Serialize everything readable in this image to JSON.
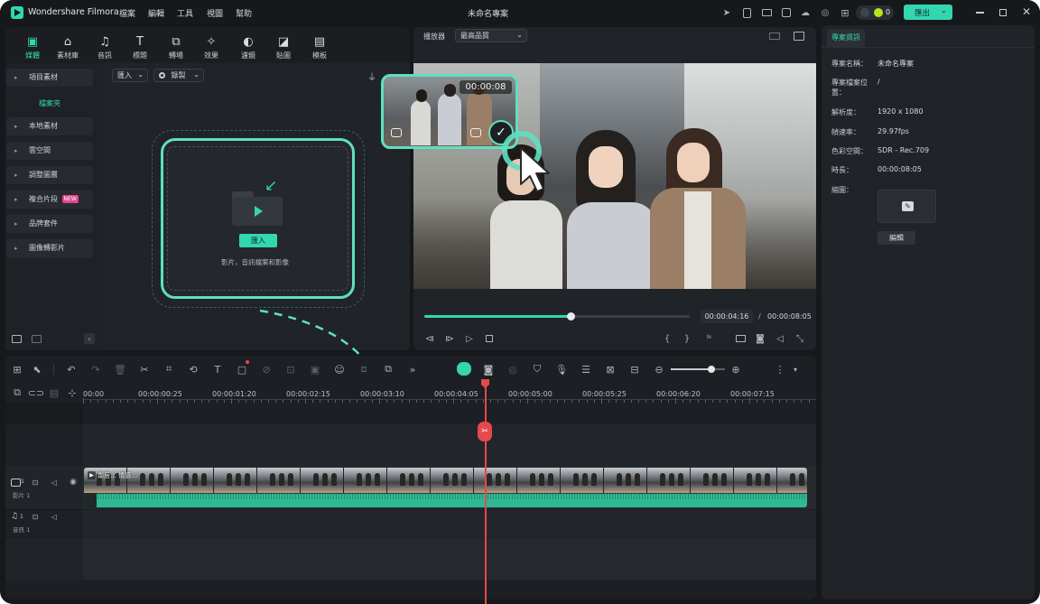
{
  "app": {
    "name": "Wondershare Filmora",
    "menu": [
      "檔案",
      "編輯",
      "工具",
      "視圖",
      "幫助"
    ],
    "project_title": "未命名專案",
    "credits": "0",
    "export_label": "匯出"
  },
  "media_tabs": [
    "媒體",
    "素材庫",
    "音訊",
    "標題",
    "轉場",
    "效果",
    "濾鏡",
    "貼圖",
    "模板"
  ],
  "sidebar": {
    "project_media": "項目素材",
    "folder": "檔案夾",
    "items": [
      "本地素材",
      "雲空間",
      "調整圖層",
      "複合片段",
      "品牌套件",
      "圖像轉影片"
    ],
    "new_badge": "NEW"
  },
  "media_toolbar": {
    "import_dropdown": "匯入",
    "record_dropdown": "錄製"
  },
  "import_area": {
    "button": "匯入",
    "hint": "影片，音訊檔案和影像"
  },
  "drag_thumb": {
    "time": "00:00:08"
  },
  "player": {
    "label": "播放器",
    "quality": "最高品質",
    "current_time": "00:00:04:16",
    "separator": "/",
    "total_time": "00:00:08:05",
    "progress": 0.55
  },
  "project_info": {
    "tab": "專案資訊",
    "rows": [
      {
        "key": "專案名稱：",
        "value": "未命名專案"
      },
      {
        "key": "專案檔案位置：",
        "value": "/"
      },
      {
        "key": "解析度：",
        "value": "1920 x 1080"
      },
      {
        "key": "幀速率：",
        "value": "29.97fps"
      },
      {
        "key": "色彩空間：",
        "value": "SDR - Rec.709"
      },
      {
        "key": "時長：",
        "value": "00:00:08:05"
      },
      {
        "key": "縮圖：",
        "value": ""
      }
    ],
    "edit_button": "編輯"
  },
  "timeline": {
    "ruler": [
      "00:00",
      "00:00:00:25",
      "00:00:01:20",
      "00:00:02:15",
      "00:00:03:10",
      "00:00:04:05",
      "00:00:05:00",
      "00:00:05:25",
      "00:00:06:20",
      "00:00:07:15"
    ],
    "video_track": "影片 1",
    "video_track_num": "1",
    "audio_track": "音訊 1",
    "audio_track_num": "1",
    "clip_name": "鄰居… 情感…",
    "zoom_level": 0.75
  },
  "colors": {
    "accent": "#34d6b0",
    "playhead": "#e5484d",
    "panel": "#202328",
    "background": "#16181c"
  }
}
